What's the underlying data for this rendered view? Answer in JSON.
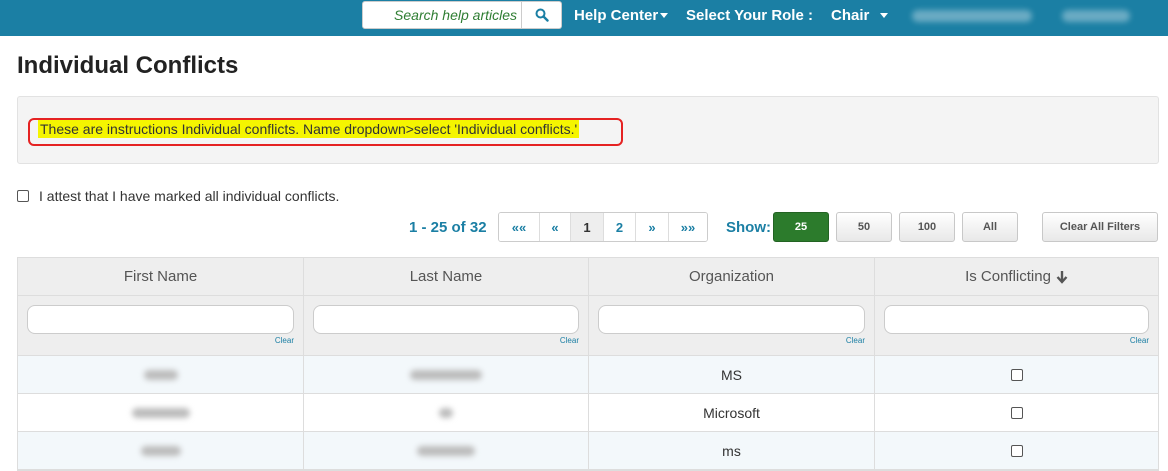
{
  "topbar": {
    "search_placeholder": "Search help articles",
    "help_center": "Help Center",
    "select_role_label": "Select Your Role :",
    "role_value": "Chair"
  },
  "page": {
    "title": "Individual Conflicts",
    "instructions": "These are instructions Individual conflicts. Name dropdown>select 'Individual conflicts.'",
    "attest_label": "I attest that I have marked all individual conflicts."
  },
  "pagination": {
    "range": "1 - 25 of 32",
    "first": "««",
    "prev": "«",
    "pages": [
      "1",
      "2"
    ],
    "next": "»",
    "last": "»»",
    "current_page": "1"
  },
  "page_size": {
    "label": "Show:",
    "options": [
      "25",
      "50",
      "100",
      "All"
    ],
    "selected": "25",
    "clear_filters": "Clear All Filters"
  },
  "table": {
    "columns": [
      "First Name",
      "Last Name",
      "Organization",
      "Is Conflicting"
    ],
    "clear_label": "Clear",
    "rows": [
      {
        "organization": "MS",
        "is_conflicting": false
      },
      {
        "organization": "Microsoft",
        "is_conflicting": false
      },
      {
        "organization": "ms",
        "is_conflicting": false
      }
    ]
  },
  "colors": {
    "topbar": "#1b7fa4",
    "accent": "#1b7fa4",
    "selected_button": "#2c7b2c",
    "highlight": "#f5f500",
    "annotation_outline": "#e52222"
  },
  "icons": {
    "search": "search-icon",
    "sort": "arrow-down-icon"
  }
}
